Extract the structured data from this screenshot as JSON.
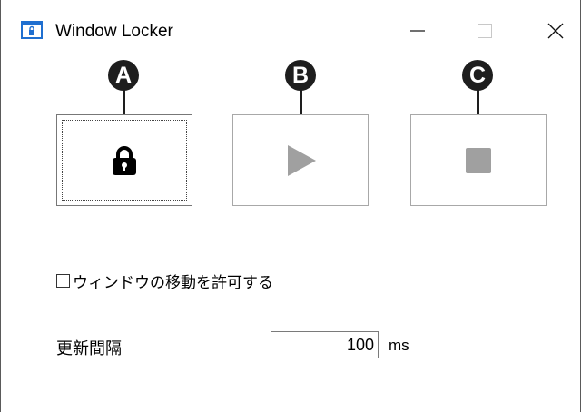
{
  "window": {
    "title": "Window Locker",
    "controls": {
      "minimize": "minimize",
      "maximize": "maximize",
      "close": "close"
    }
  },
  "callouts": [
    "A",
    "B",
    "C"
  ],
  "toolbar": {
    "buttons": [
      {
        "name": "lock",
        "icon": "lock-icon"
      },
      {
        "name": "play",
        "icon": "play-icon"
      },
      {
        "name": "stop",
        "icon": "stop-icon"
      }
    ]
  },
  "options": {
    "allow_move_label": "ウィンドウの移動を許可する",
    "allow_move_checked": false
  },
  "interval": {
    "label": "更新間隔",
    "value": "100",
    "unit": "ms"
  },
  "colors": {
    "callout_bg": "#1e1e1e",
    "disabled_icon": "#a0a0a0",
    "app_icon": "#1f6fd0"
  }
}
